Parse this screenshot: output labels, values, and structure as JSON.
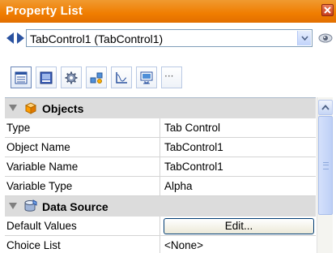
{
  "window": {
    "title": "Property List"
  },
  "object_selector": {
    "value": "TabControl1 (TabControl1)"
  },
  "toolbar": {
    "buttons": [
      {
        "icon": "list-icon",
        "active": true
      },
      {
        "icon": "appearance-icon"
      },
      {
        "icon": "gear-icon"
      },
      {
        "icon": "objects-icon"
      },
      {
        "icon": "graph-icon"
      },
      {
        "icon": "display-icon"
      },
      {
        "icon": "more-icon",
        "label": "···"
      }
    ]
  },
  "categories": [
    {
      "label": "Objects",
      "icon": "cube-icon",
      "properties": [
        {
          "name": "Type",
          "value": "Tab Control"
        },
        {
          "name": "Object Name",
          "value": "TabControl1"
        },
        {
          "name": "Variable Name",
          "value": "TabControl1"
        },
        {
          "name": "Variable Type",
          "value": "Alpha"
        }
      ]
    },
    {
      "label": "Data Source",
      "icon": "database-icon",
      "properties": [
        {
          "name": "Default Values",
          "value": "Edit..."
        },
        {
          "name": "Choice List",
          "value": "<None>"
        }
      ]
    }
  ],
  "colors": {
    "title_bar": "#f07d00",
    "category_bg": "#dcdcdc",
    "grid_line": "#d4d4d4"
  }
}
